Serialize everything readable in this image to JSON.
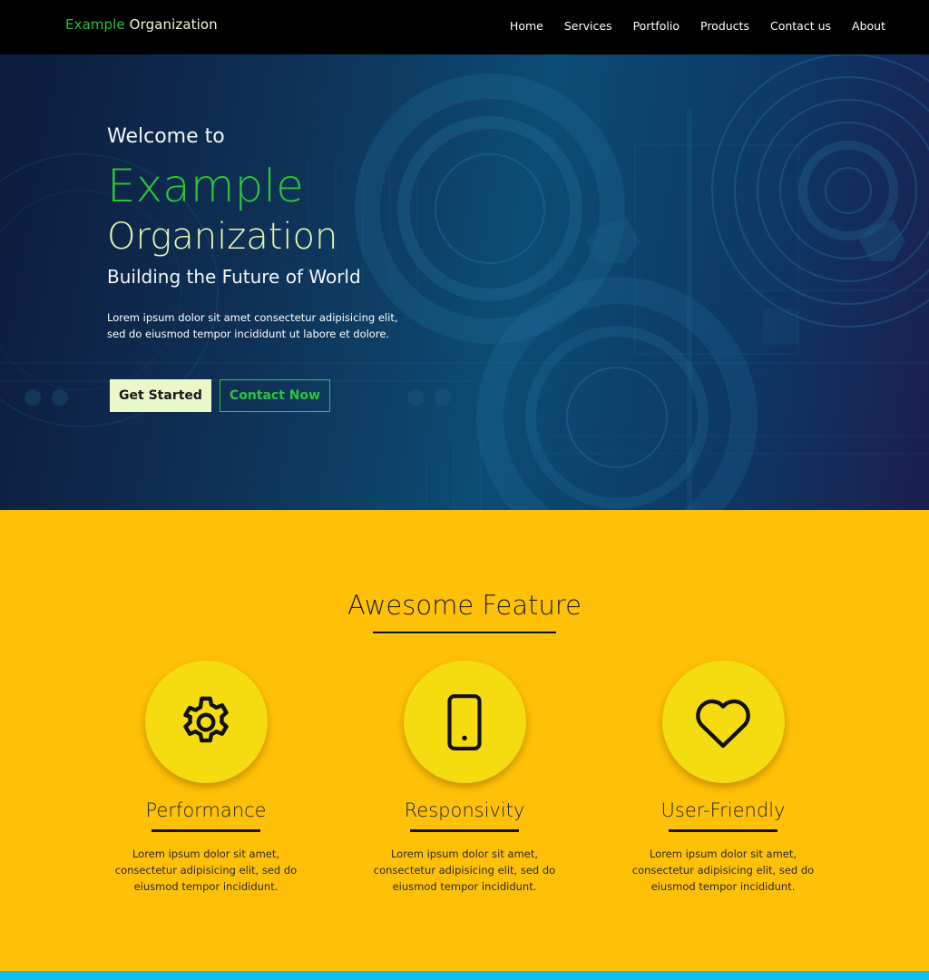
{
  "brand": {
    "part1": "Example",
    "part2": "Organization"
  },
  "nav": {
    "items": [
      {
        "label": "Home"
      },
      {
        "label": "Services"
      },
      {
        "label": "Portfolio"
      },
      {
        "label": "Products"
      },
      {
        "label": "Contact us"
      },
      {
        "label": "About"
      }
    ]
  },
  "hero": {
    "welcome": "Welcome to",
    "name_line1": "Example",
    "name_line2": "Organization",
    "tagline": "Building the Future of World",
    "description": "Lorem ipsum dolor sit amet consectetur adipisicing elit, sed do eiusmod tempor incididunt ut labore et dolore.",
    "primary_button": "Get Started",
    "secondary_button": "Contact Now"
  },
  "features": {
    "title": "Awesome Feature",
    "items": [
      {
        "icon": "gear-icon",
        "title": "Performance",
        "description": "Lorem ipsum dolor sit amet, consectetur adipisicing elit, sed do eiusmod tempor incididunt."
      },
      {
        "icon": "smartphone-icon",
        "title": "Responsivity",
        "description": "Lorem ipsum dolor sit amet, consectetur adipisicing elit, sed do eiusmod tempor incididunt."
      },
      {
        "icon": "heart-icon",
        "title": "User-Friendly",
        "description": "Lorem ipsum dolor sit amet, consectetur adipisicing elit, sed do eiusmod tempor incididunt."
      }
    ]
  },
  "colors": {
    "brand_green": "#2ec43a",
    "brand_light": "#e8f7b4",
    "navbar_bg": "#000000",
    "features_bg": "#ffc107",
    "feature_circle": "#f4dc10",
    "bottom_strip": "#0fc0ef"
  }
}
